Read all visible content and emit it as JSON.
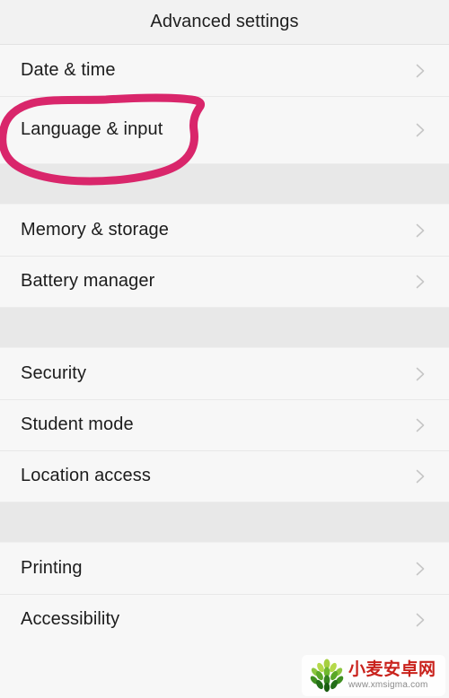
{
  "header": {
    "title": "Advanced settings"
  },
  "groups": [
    {
      "id": "group-1",
      "items": [
        {
          "label": "Date & time",
          "icon": "chevron-right-icon",
          "highlighted": false
        },
        {
          "label": "Language & input",
          "icon": "chevron-right-icon",
          "highlighted": true
        }
      ]
    },
    {
      "id": "group-2",
      "items": [
        {
          "label": "Memory & storage",
          "icon": "chevron-right-icon",
          "highlighted": false
        },
        {
          "label": "Battery manager",
          "icon": "chevron-right-icon",
          "highlighted": false
        }
      ]
    },
    {
      "id": "group-3",
      "items": [
        {
          "label": "Security",
          "icon": "chevron-right-icon",
          "highlighted": false
        },
        {
          "label": "Student mode",
          "icon": "chevron-right-icon",
          "highlighted": false
        },
        {
          "label": "Location access",
          "icon": "chevron-right-icon",
          "highlighted": false
        }
      ]
    },
    {
      "id": "group-4",
      "items": [
        {
          "label": "Printing",
          "icon": "chevron-right-icon",
          "highlighted": false
        },
        {
          "label": "Accessibility",
          "icon": "chevron-right-icon",
          "highlighted": false
        }
      ]
    }
  ],
  "annotation": {
    "type": "hand-drawn-ellipse",
    "target_label": "Language & input",
    "color": "#d9266b"
  },
  "watermark": {
    "logo_icon": "wheat-logo-icon",
    "site_name": "小麦安卓网",
    "site_url": "www.xmsigma.com",
    "name_color": "#c9221c",
    "url_color": "#8a8a8a"
  },
  "colors": {
    "page_background": "#f7f7f7",
    "header_background": "#f2f2f2",
    "separator_band": "#e8e8e8",
    "row_divider": "#e8e8e8",
    "label_text": "#1c1c1c",
    "chevron": "#c6c6c6",
    "annotation_pink": "#d9266b"
  }
}
